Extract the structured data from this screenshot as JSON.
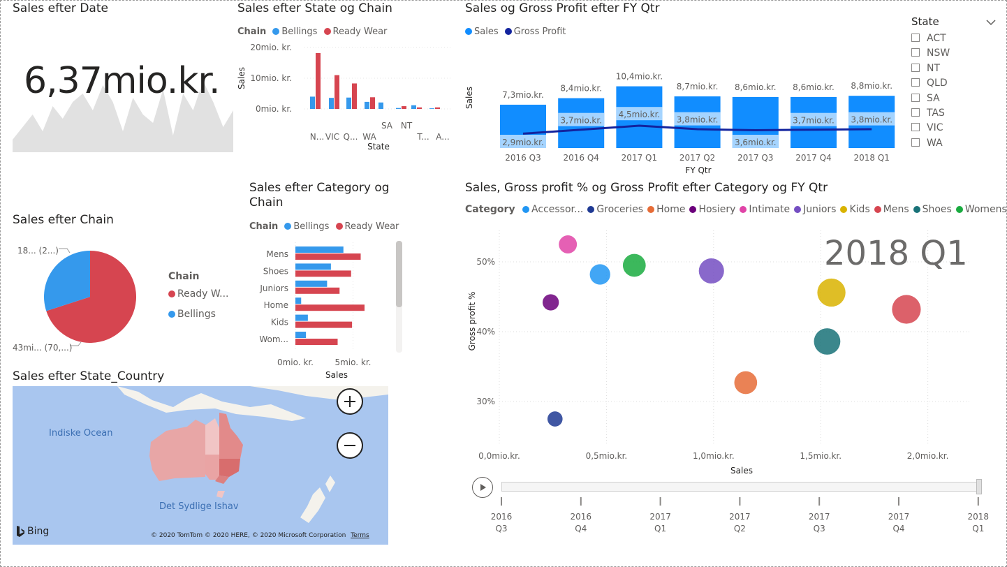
{
  "card": {
    "title": "Sales efter Date",
    "value": "6,37mio.kr.",
    "chart_data": {
      "type": "area",
      "values": [
        3,
        6,
        9,
        5,
        11,
        8,
        12,
        14,
        10,
        16,
        12,
        5,
        13,
        9,
        7,
        15,
        4,
        14,
        10,
        17,
        12,
        6,
        10
      ]
    }
  },
  "state_chain": {
    "title": "Sales efter State og Chain",
    "legend_title": "Chain",
    "legend": [
      "Bellings",
      "Ready Wear"
    ],
    "ylabel": "Sales",
    "xlabel": "State",
    "yticks": [
      "20mio. kr.",
      "10mio. kr.",
      "0mio. kr."
    ],
    "xticks": [
      "N...",
      "VIC",
      "Q...",
      "WA",
      "SA",
      "NT",
      "T...",
      "A..."
    ],
    "chart_data": {
      "type": "bar",
      "categories": [
        "N...",
        "VIC",
        "Q...",
        "WA",
        "SA",
        "NT",
        "T...",
        "A..."
      ],
      "series": [
        {
          "name": "Bellings",
          "values": [
            4.0,
            3.6,
            3.7,
            2.3,
            2.1,
            0.3,
            1.2,
            0.2
          ]
        },
        {
          "name": "Ready Wear",
          "values": [
            18.2,
            11.0,
            8.3,
            3.8,
            0.0,
            0.9,
            0.5,
            0.5
          ]
        }
      ],
      "ylim": [
        0,
        20
      ]
    }
  },
  "fyqtr": {
    "title": "Sales og Gross Profit efter FY Qtr",
    "legend": [
      "Sales",
      "Gross Profit"
    ],
    "ylabel": "Sales",
    "xlabel": "FY Qtr",
    "chart_data": {
      "type": "bar",
      "categories": [
        "2016 Q3",
        "2016 Q4",
        "2017 Q1",
        "2017 Q2",
        "2017 Q3",
        "2017 Q4",
        "2018 Q1"
      ],
      "series": [
        {
          "name": "Sales",
          "values": [
            7.3,
            8.4,
            10.4,
            8.7,
            8.6,
            8.6,
            8.8
          ],
          "labels": [
            "7,3mio.kr.",
            "8,4mio.kr.",
            "10,4mio.kr.",
            "8,7mio.kr.",
            "8,6mio.kr.",
            "8,6mio.kr.",
            "8,8mio.kr."
          ]
        },
        {
          "name": "Gross Profit",
          "values": [
            2.9,
            3.7,
            4.5,
            3.8,
            3.6,
            3.7,
            3.8
          ],
          "labels": [
            "2,9mio.kr.",
            "3,7mio.kr.",
            "4,5mio.kr.",
            "3,8mio.kr.",
            "3,6mio.kr.",
            "3,7mio.kr.",
            "3,8mio.kr."
          ]
        }
      ]
    }
  },
  "slicer": {
    "title": "State",
    "items": [
      "ACT",
      "NSW",
      "NT",
      "QLD",
      "SA",
      "TAS",
      "VIC",
      "WA"
    ]
  },
  "pie": {
    "title": "Sales efter Chain",
    "legend_title": "Chain",
    "legend": [
      "Ready W...",
      "Bellings"
    ],
    "label_top": "18... (2...)",
    "label_bottom": "43mi... (70,...)",
    "chart_data": {
      "type": "pie",
      "categories": [
        "Ready Wear",
        "Bellings"
      ],
      "values": [
        70,
        30
      ]
    }
  },
  "cat_chain": {
    "title": "Sales efter Category og Chain",
    "legend_title": "Chain",
    "legend": [
      "Bellings",
      "Ready Wear"
    ],
    "xlabel": "Sales",
    "xticks": [
      "0mio. kr.",
      "5mio. kr."
    ],
    "chart_data": {
      "type": "bar",
      "categories": [
        "Mens",
        "Shoes",
        "Juniors",
        "Home",
        "Kids",
        "Wom..."
      ],
      "series": [
        {
          "name": "Bellings",
          "values": [
            5.0,
            3.7,
            3.3,
            0.6,
            1.3,
            1.1
          ]
        },
        {
          "name": "Ready Wear",
          "values": [
            6.8,
            5.8,
            4.6,
            7.2,
            5.9,
            4.4
          ]
        }
      ],
      "xlim": [
        0,
        8
      ]
    }
  },
  "map": {
    "title": "Sales efter State_Country",
    "label_ocean1": "Indiske Ocean",
    "label_ocean2": "Det Sydlige Ishav",
    "bing": "Bing",
    "copyright": "© 2020 TomTom © 2020 HERE, © 2020 Microsoft Corporation",
    "terms": "Terms"
  },
  "scatter": {
    "title": "Sales, Gross profit % og Gross Profit efter Category og FY Qtr",
    "legend_title": "Category",
    "play_label": "2018 Q1",
    "ylabel": "Gross profit %",
    "xlabel": "Sales",
    "xticks": [
      "0,0mio.kr.",
      "0,5mio.kr.",
      "1,0mio.kr.",
      "1,5mio.kr.",
      "2,0mio.kr."
    ],
    "yticks": [
      "50%",
      "40%",
      "30%"
    ],
    "timeline": [
      [
        "2016",
        "Q3"
      ],
      [
        "2016",
        "Q4"
      ],
      [
        "2017",
        "Q1"
      ],
      [
        "2017",
        "Q2"
      ],
      [
        "2017",
        "Q3"
      ],
      [
        "2017",
        "Q4"
      ],
      [
        "2018",
        "Q1"
      ]
    ],
    "chart_data": {
      "type": "scatter",
      "points": [
        {
          "category": "Accessor...",
          "color": "#2196f3",
          "x": 0.47,
          "y": 48.2,
          "size": 0.9
        },
        {
          "category": "Groceries",
          "color": "#1f3a93",
          "x": 0.26,
          "y": 27.5,
          "size": 0.45
        },
        {
          "category": "Home",
          "color": "#e66c37",
          "x": 1.15,
          "y": 32.7,
          "size": 1.1
        },
        {
          "category": "Hosiery",
          "color": "#6b007b",
          "x": 0.24,
          "y": 44.2,
          "size": 0.55
        },
        {
          "category": "Intimate",
          "color": "#e044a7",
          "x": 0.32,
          "y": 52.5,
          "size": 0.7
        },
        {
          "category": "Juniors",
          "color": "#744ec2",
          "x": 0.99,
          "y": 48.7,
          "size": 1.3
        },
        {
          "category": "Kids",
          "color": "#d9b300",
          "x": 1.55,
          "y": 45.6,
          "size": 1.55
        },
        {
          "category": "Mens",
          "color": "#d64550",
          "x": 1.9,
          "y": 43.2,
          "size": 1.6
        },
        {
          "category": "Shoes",
          "color": "#197278",
          "x": 1.53,
          "y": 38.6,
          "size": 1.4
        },
        {
          "category": "Womens",
          "color": "#1aab40",
          "x": 0.63,
          "y": 49.5,
          "size": 1.1
        }
      ]
    }
  },
  "colors": {
    "bellings": "#3599ec",
    "readywear": "#d64550",
    "sales": "#118dff",
    "gross_profit": "#12239e"
  }
}
